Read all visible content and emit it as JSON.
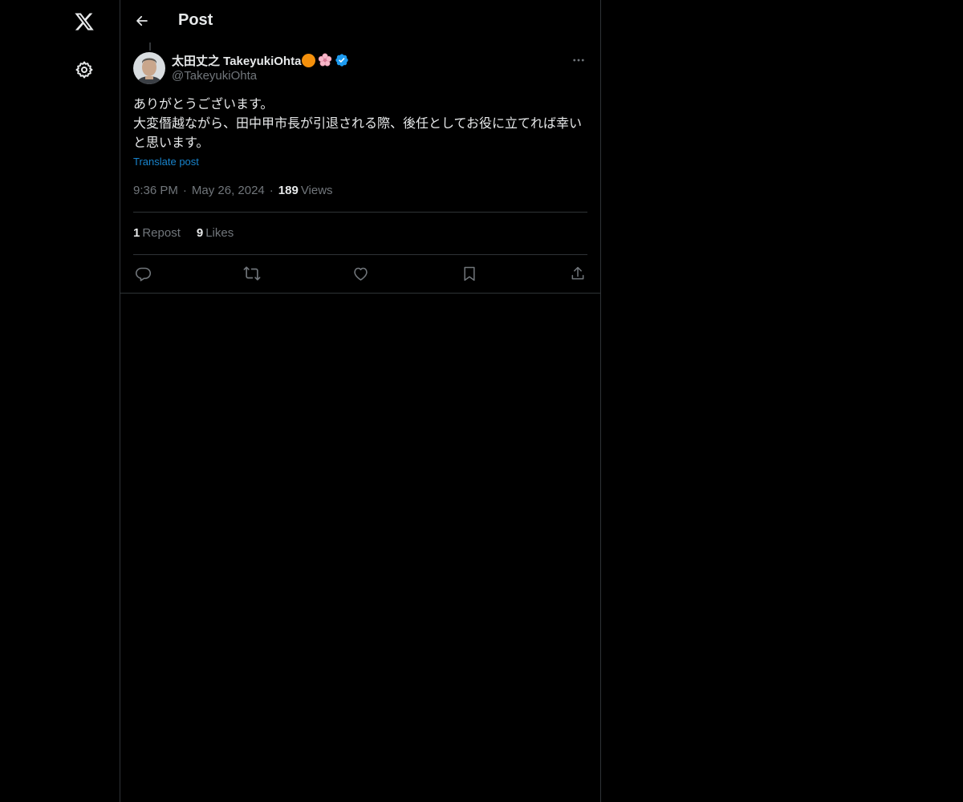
{
  "header": {
    "title": "Post"
  },
  "post": {
    "author_name": "太田丈之 TakeyukiOhta",
    "handle": "@TakeyukiOhta",
    "body": "ありがとうございます。\n大変僭越ながら、田中甲市長が引退される際、後任としてお役に立てれば幸いと思います。",
    "translate_label": "Translate post",
    "time": "9:36 PM",
    "date": "May 26, 2024",
    "views_count": "189",
    "views_label": "Views",
    "reposts_count": "1",
    "reposts_label": "Repost",
    "likes_count": "9",
    "likes_label": "Likes"
  },
  "icons": {
    "logo": "x-logo-icon",
    "settings": "gear-icon",
    "back": "back-arrow-icon",
    "more": "more-horizontal-icon",
    "actions": [
      "reply-icon",
      "repost-icon",
      "like-icon",
      "bookmark-icon",
      "share-icon"
    ]
  },
  "colors": {
    "background": "#000000",
    "text": "#e7e9ea",
    "muted": "#71767b",
    "accent": "#1d9bf0",
    "border": "#2f3336"
  }
}
